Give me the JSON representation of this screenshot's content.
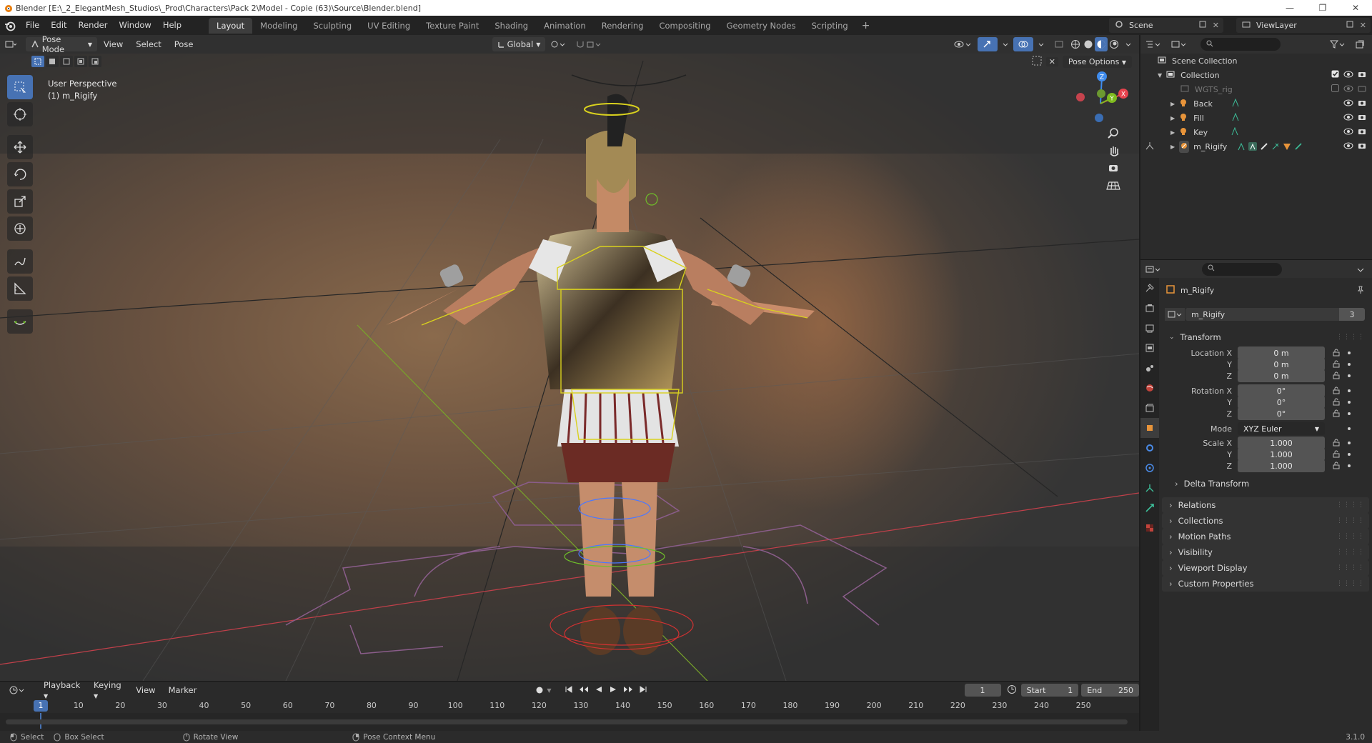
{
  "window": {
    "title": "Blender [E:\\_2_ElegantMesh_Studios\\_Prod\\Characters\\Pack 2\\Model - Copie (63)\\Source\\Blender.blend]",
    "controls": [
      "—",
      "❐",
      "✕"
    ]
  },
  "menubar": {
    "menus": [
      "File",
      "Edit",
      "Render",
      "Window",
      "Help"
    ],
    "workspaces": [
      "Layout",
      "Modeling",
      "Sculpting",
      "UV Editing",
      "Texture Paint",
      "Shading",
      "Animation",
      "Rendering",
      "Compositing",
      "Geometry Nodes",
      "Scripting"
    ],
    "active_workspace": "Layout",
    "add": "+",
    "scene": "Scene",
    "view_layer": "ViewLayer"
  },
  "viewport_header": {
    "mode": "Pose Mode",
    "menus": [
      "View",
      "Select",
      "Pose"
    ],
    "orientation": "Global"
  },
  "viewport": {
    "view_name": "User Perspective",
    "object_label": "(1) m_Rigify",
    "pose_options": "Pose Options",
    "gizmo_axes": {
      "x": "X",
      "y": "Y",
      "z": "Z"
    },
    "colors": {
      "accent": "#4772b3",
      "x_axis": "#e8434e",
      "y_axis": "#7fba1f",
      "z_axis": "#3f8ced",
      "bone_select": "#d9d11e"
    }
  },
  "toolbar": {
    "tools": [
      "select-box-icon",
      "cursor-icon",
      "move-icon",
      "rotate-icon",
      "scale-icon",
      "transform-icon",
      "annotate-icon",
      "measure-icon",
      "relax-icon"
    ]
  },
  "timeline": {
    "menus": [
      "Playback",
      "Keying",
      "View",
      "Marker"
    ],
    "current_frame": "1",
    "start_label": "Start",
    "start": "1",
    "end_label": "End",
    "end": "250",
    "ruler_ticks": [
      "1",
      "10",
      "20",
      "30",
      "40",
      "50",
      "60",
      "70",
      "80",
      "90",
      "100",
      "110",
      "120",
      "130",
      "140",
      "150",
      "160",
      "170",
      "180",
      "190",
      "200",
      "210",
      "220",
      "230",
      "240",
      "250"
    ]
  },
  "statusbar": {
    "items": [
      "Select",
      "Box Select",
      "Rotate View",
      "Pose Context Menu"
    ],
    "version": "3.1.0"
  },
  "outliner": {
    "scene_collection": "Scene Collection",
    "collection": "Collection",
    "items": [
      "WGTS_rig",
      "Back",
      "Fill",
      "Key",
      "m_Rigify"
    ]
  },
  "properties": {
    "object_name": "m_Rigify",
    "data_name": "m_Rigify",
    "users": "3",
    "transform_title": "Transform",
    "location": {
      "label_x": "Location X",
      "label_y": "Y",
      "label_z": "Z",
      "x": "0 m",
      "y": "0 m",
      "z": "0 m"
    },
    "rotation": {
      "label_x": "Rotation X",
      "label_y": "Y",
      "label_z": "Z",
      "x": "0°",
      "y": "0°",
      "z": "0°"
    },
    "mode_label": "Mode",
    "mode_value": "XYZ Euler",
    "scale": {
      "label_x": "Scale X",
      "label_y": "Y",
      "label_z": "Z",
      "x": "1.000",
      "y": "1.000",
      "z": "1.000"
    },
    "delta_transform": "Delta Transform",
    "panels": [
      "Relations",
      "Collections",
      "Motion Paths",
      "Visibility",
      "Viewport Display",
      "Custom Properties"
    ]
  }
}
